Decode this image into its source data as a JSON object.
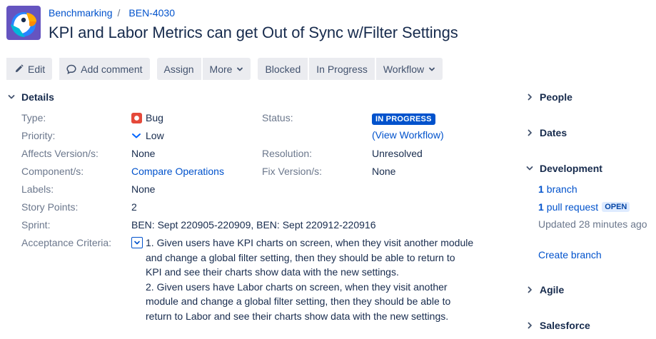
{
  "breadcrumb": {
    "project": "Benchmarking",
    "separator": "/",
    "issue_key": "BEN-4030"
  },
  "title": "KPI and Labor Metrics can get Out of Sync w/Filter Settings",
  "toolbar": {
    "edit": "Edit",
    "add_comment": "Add comment",
    "assign": "Assign",
    "more": "More",
    "blocked": "Blocked",
    "in_progress": "In Progress",
    "workflow": "Workflow"
  },
  "details": {
    "heading": "Details",
    "type_label": "Type:",
    "type_value": "Bug",
    "priority_label": "Priority:",
    "priority_value": "Low",
    "affects_label": "Affects Version/s:",
    "affects_value": "None",
    "component_label": "Component/s:",
    "component_value": "Compare Operations",
    "labels_label": "Labels:",
    "labels_value": "None",
    "story_points_label": "Story Points:",
    "story_points_value": "2",
    "sprint_label": "Sprint:",
    "sprint_value": "BEN: Sept 220905-220909, BEN: Sept 220912-220916",
    "acceptance_label": "Acceptance Criteria:",
    "status_label": "Status:",
    "status_value": "IN PROGRESS",
    "view_workflow": "(View Workflow)",
    "resolution_label": "Resolution:",
    "resolution_value": "Unresolved",
    "fix_label": "Fix Version/s:",
    "fix_value": "None"
  },
  "acceptance_criteria": [
    "1. Given users have KPI charts on screen, when they visit another module",
    "and change a global filter setting, then they should be able to return to",
    "KPI and see their charts show data with the new settings.",
    "2. Given users have Labor charts on screen, when they visit another",
    "module and change a global filter setting, then they should be able to",
    "return to Labor and see their charts show data with the new settings."
  ],
  "sidebar": {
    "people": "People",
    "dates": "Dates",
    "development": "Development",
    "branch_count": "1",
    "branch_label": "branch",
    "pr_count": "1",
    "pr_label": "pull request",
    "pr_status": "OPEN",
    "updated": "Updated 28 minutes ago",
    "create_branch": "Create branch",
    "agile": "Agile",
    "salesforce": "Salesforce"
  },
  "colors": {
    "link": "#0052cc",
    "status_blue": "#0052cc",
    "bug_red": "#e5493a",
    "button_bg": "#ebecf0",
    "label_grey": "#6b778c"
  },
  "icons": {
    "project_avatar": "parrot-avatar-icon",
    "edit": "pencil-icon",
    "comment": "speech-bubble-icon",
    "more_caret": "chevron-down-icon",
    "bug": "bug-icon",
    "priority_low": "chevron-down-icon",
    "section_collapsed": "chevron-right-icon",
    "section_expanded": "chevron-down-icon"
  }
}
